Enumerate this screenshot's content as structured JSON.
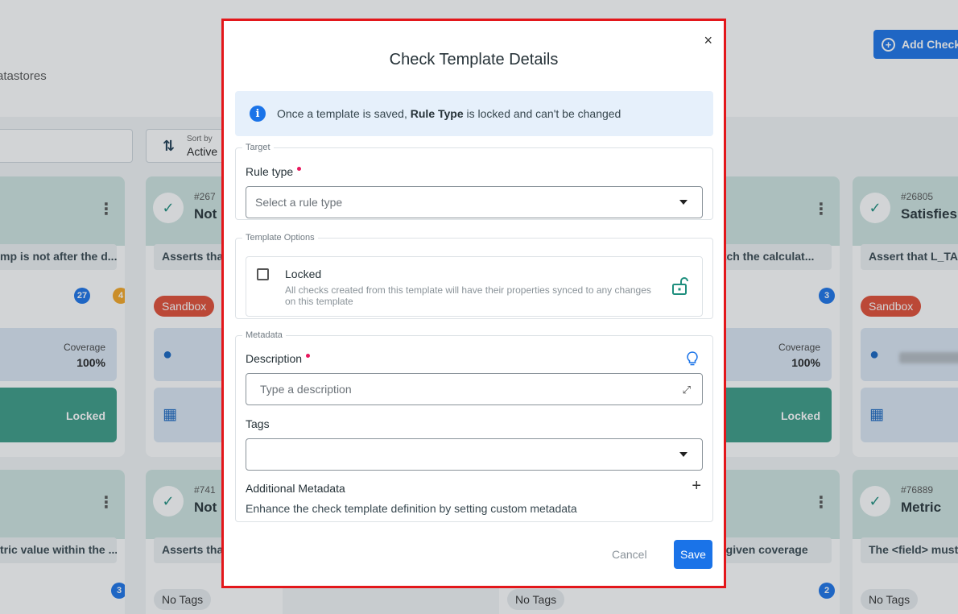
{
  "background": {
    "breadcrumb": "atastores",
    "add_check_label": "Add Check",
    "sort_small_label": "Sort by",
    "sort_value": "Active",
    "cards": [
      {
        "menu": "⋮",
        "desc": "mp is not after the d...",
        "count_primary": "27",
        "count_warning": "4",
        "coverage_label": "Coverage",
        "coverage_value": "100%",
        "locked_label": "Locked"
      },
      {
        "id": "#267",
        "name": "Not",
        "menu": "⋮",
        "desc": "Asserts tha",
        "tag": "Sandbox"
      },
      {
        "menu": "⋮",
        "desc": "atch the calculat...",
        "count_primary": "3",
        "coverage_label": "Coverage",
        "coverage_value": "100%",
        "locked_label": "Locked"
      },
      {
        "id": "#26805",
        "name": "Satisfies",
        "desc": "Assert that L_TA",
        "tag": "Sandbox"
      },
      {
        "menu": "⋮",
        "desc": "tric value within the ...",
        "count_primary": "3"
      },
      {
        "id": "#741",
        "name": "Not",
        "menu": "⋮",
        "desc": "Asserts tha",
        "tag": "No Tags"
      },
      {
        "menu": "⋮",
        "desc": "e given coverage",
        "tag": "No Tags",
        "count_primary": "2"
      },
      {
        "id": "#76889",
        "name": "Metric",
        "desc": "The <field> must",
        "tag": "No Tags"
      }
    ]
  },
  "modal": {
    "title": "Check Template Details",
    "close_icon": "×",
    "info": {
      "prefix": "Once a template is saved,",
      "bold": "Rule Type",
      "suffix": "is locked and can't be changed"
    },
    "target": {
      "legend": "Target",
      "rule_type_label": "Rule type",
      "rule_type_placeholder": "Select a rule type"
    },
    "template_options": {
      "legend": "Template Options",
      "locked_label": "Locked",
      "locked_help": "All checks created from this template will have their properties synced to any changes on this template"
    },
    "metadata": {
      "legend": "Metadata",
      "description_label": "Description",
      "description_placeholder": "Type a description",
      "tags_label": "Tags",
      "additional_title": "Additional Metadata",
      "additional_plus": "+",
      "additional_help": "Enhance the check template definition by setting custom metadata"
    },
    "cancel_label": "Cancel",
    "save_label": "Save"
  },
  "colors": {
    "accent": "#1a73e8",
    "highlight_border": "#e3171b",
    "required": "#e8175d",
    "sandbox": "#e24c34",
    "locked_green": "#3a9b86"
  }
}
